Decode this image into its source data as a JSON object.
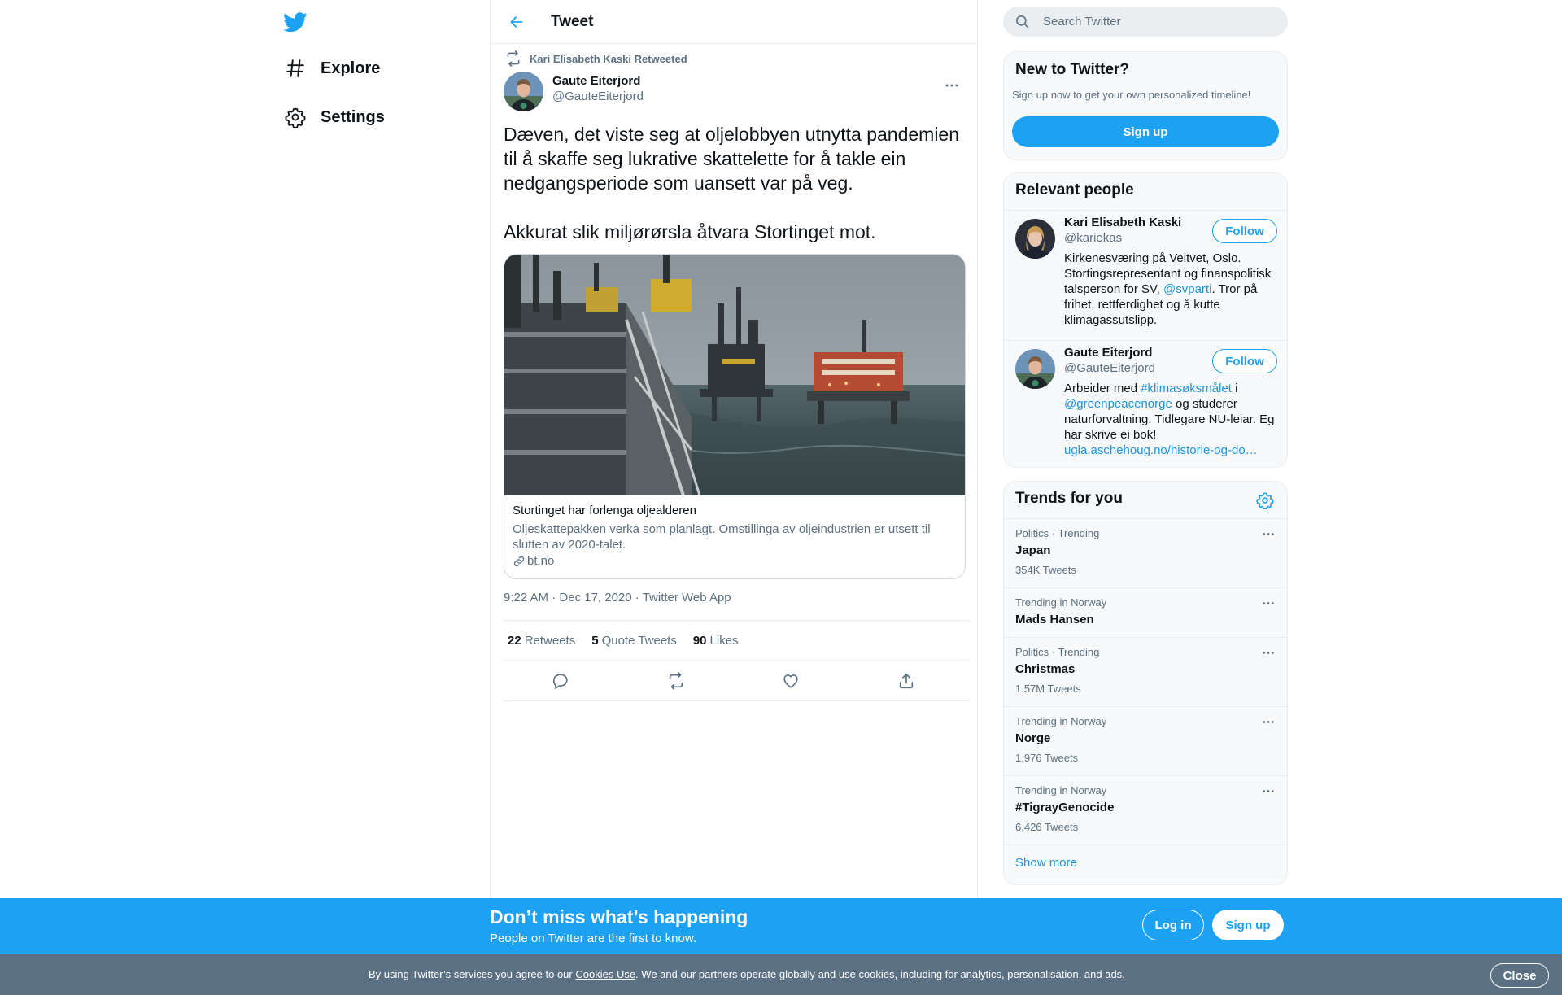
{
  "nav": {
    "explore_label": "Explore",
    "settings_label": "Settings"
  },
  "header": {
    "title": "Tweet"
  },
  "tweet": {
    "retweeted_by": "Kari Elisabeth Kaski Retweeted",
    "author_name": "Gaute Eiterjord",
    "author_handle": "@GauteEiterjord",
    "text_lines": [
      "Dæven, det viste seg at oljelobbyen utnytta pandemien",
      "til å skaffe seg lukrative skattelette for å takle ein",
      "nedgangsperiode som uansett var på veg.",
      "Akkurat slik miljørørsla åtvara Stortinget mot."
    ],
    "card": {
      "title": "Stortinget har forlenga oljealderen",
      "description_line1": "Oljeskattepakken verka som planlagt. Omstillinga av oljeindustrien er utsett til",
      "description_line2": "slutten av 2020-talet.",
      "domain": "bt.no"
    },
    "time": "9:22 AM",
    "date": "Dec 17, 2020",
    "source": "Twitter Web App",
    "separator": "·",
    "stats": {
      "retweets_count": "22",
      "retweets_label": "Retweets",
      "quotes_count": "5",
      "quotes_label": "Quote Tweets",
      "likes_count": "90",
      "likes_label": "Likes"
    }
  },
  "search": {
    "placeholder": "Search Twitter"
  },
  "new_panel": {
    "title": "New to Twitter?",
    "subtitle": "Sign up now to get your own personalized timeline!",
    "signup_label": "Sign up"
  },
  "relevant": {
    "title": "Relevant people",
    "people": [
      {
        "name": "Kari Elisabeth Kaski",
        "handle": "@kariekas",
        "follow_label": "Follow",
        "bio": {
          "l1": "Kirkenesværing på Veitvet, Oslo.",
          "l2": "Stortingsrepresentant og finanspolitisk",
          "l3_pre": "talsperson for SV, ",
          "l3_link": "@svparti",
          "l3_post": ". Tror på",
          "l4": "frihet, rettferdighet og å kutte",
          "l5": "klimagassutslipp."
        }
      },
      {
        "name": "Gaute Eiterjord",
        "handle": "@GauteEiterjord",
        "follow_label": "Follow",
        "bio": {
          "l1_pre": "Arbeider med ",
          "l1_link": "#klimasøksmålet",
          "l1_post": " i",
          "l2_link": "@greenpeacenorge",
          "l2_post": " og studerer",
          "l3": "naturforvaltning. Tidlegare NU-leiar. Eg",
          "l4": "har skrive ei bok!",
          "l5_link": "ugla.aschehoug.no/historie-og-do…"
        }
      }
    ]
  },
  "trends": {
    "title": "Trends for you",
    "items": [
      {
        "context": "Politics · Trending",
        "name": "Japan",
        "count": "354K Tweets"
      },
      {
        "context": "Trending in Norway",
        "name": "Mads Hansen",
        "count": ""
      },
      {
        "context": "Politics · Trending",
        "name": "Christmas",
        "count": "1.57M Tweets"
      },
      {
        "context": "Trending in Norway",
        "name": "Norge",
        "count": "1,976 Tweets"
      },
      {
        "context": "Trending in Norway",
        "name": "#TigrayGenocide",
        "count": "6,426 Tweets"
      }
    ],
    "show_more": "Show more"
  },
  "signup_bar": {
    "title": "Don’t miss what’s happening",
    "subtitle": "People on Twitter are the first to know.",
    "login_label": "Log in",
    "signup_label": "Sign up"
  },
  "cookie_bar": {
    "text_pre": "By using Twitter’s services you agree to our ",
    "link": "Cookies Use",
    "text_post": ". We and our partners operate globally and use cookies, including for analytics, personalisation, and ads.",
    "close_label": "Close"
  },
  "colors": {
    "accent": "#1da1f2",
    "link": "#1b95e0",
    "secondary_text": "#5b7083",
    "cookie_bar": "#5b7083"
  }
}
